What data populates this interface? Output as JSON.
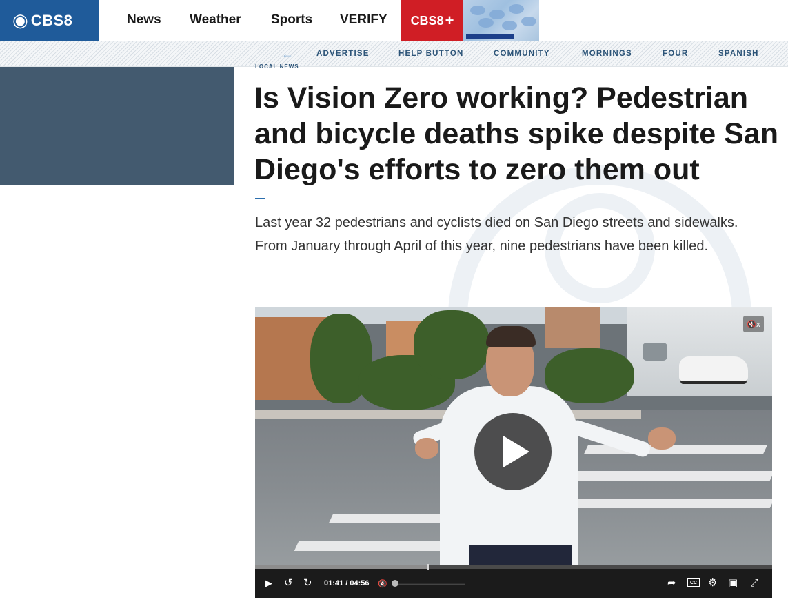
{
  "brand": {
    "logo_text": "CBS8",
    "logo_mark": "◉",
    "accent": "#1f5b9a",
    "plus_color": "#d01e25"
  },
  "topnav": {
    "items": [
      "News",
      "Weather",
      "Sports",
      "VERIFY"
    ],
    "cbs8plus_label": "CBS8",
    "cbs8plus_mark": "+"
  },
  "subnav": {
    "back_icon": "←",
    "items": [
      "ADVERTISE",
      "HELP BUTTON",
      "COMMUNITY",
      "MORNINGS",
      "FOUR",
      "SPANISH"
    ]
  },
  "article": {
    "kicker": "LOCAL NEWS",
    "headline": "Is Vision Zero working? Pedestrian and bicycle deaths spike despite San Diego's efforts to zero them out",
    "dek": "Last year 32 pedestrians and cyclists died on San Diego streets and sidewalks. From January through April of this year, nine pedestrians have been killed."
  },
  "video": {
    "progress": 0.335,
    "time_current": "01:41",
    "time_total": "04:56",
    "time_separator": "/",
    "mute_top_label": "🔇x",
    "icons": {
      "play": "▶",
      "rewind": "↺",
      "forward": "↻",
      "mute": "🔇",
      "share": "➦",
      "cc": "CC",
      "settings": "⚙",
      "pip": "▣",
      "fullscreen": "⤢"
    }
  }
}
